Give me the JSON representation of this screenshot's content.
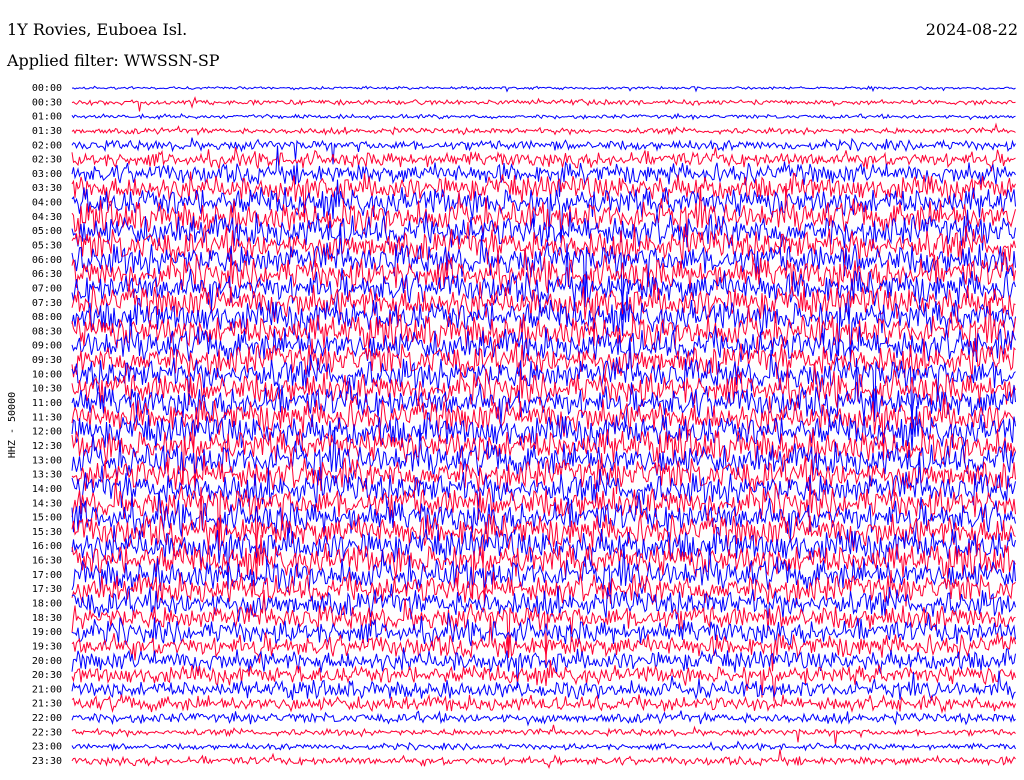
{
  "header": {
    "station": "1Y Rovies, Euboea Isl.",
    "filter": "Applied filter: WWSSN-SP",
    "date": "2024-08-22"
  },
  "chart_data": {
    "type": "line",
    "title": "1Y Rovies, Euboea Isl.",
    "subtitle": "Applied filter: WWSSN-SP",
    "ylabel": "HHZ - 50000",
    "date": "2024-08-22",
    "rows": [
      "00:00",
      "00:30",
      "01:00",
      "01:30",
      "02:00",
      "02:30",
      "03:00",
      "03:30",
      "04:00",
      "04:30",
      "05:00",
      "05:30",
      "06:00",
      "06:30",
      "07:00",
      "07:30",
      "08:00",
      "08:30",
      "09:00",
      "09:30",
      "10:00",
      "10:30",
      "11:00",
      "11:30",
      "12:00",
      "12:30",
      "13:00",
      "13:30",
      "14:00",
      "14:30",
      "15:00",
      "15:30",
      "16:00",
      "16:30",
      "17:00",
      "17:30",
      "18:00",
      "18:30",
      "19:00",
      "19:30",
      "20:00",
      "20:30",
      "21:00",
      "21:30",
      "22:00",
      "22:30",
      "23:00",
      "23:30"
    ],
    "series_colors": [
      "#0000ff",
      "#ff0033"
    ],
    "amplitude_profile": [
      0.08,
      0.15,
      0.12,
      0.18,
      0.3,
      0.45,
      0.6,
      0.75,
      0.85,
      0.9,
      0.95,
      0.95,
      0.95,
      0.95,
      0.95,
      0.95,
      0.95,
      0.95,
      0.95,
      0.95,
      0.95,
      0.95,
      0.95,
      0.95,
      0.95,
      0.95,
      0.95,
      0.95,
      0.95,
      0.95,
      0.95,
      0.95,
      0.95,
      0.95,
      0.9,
      0.85,
      0.8,
      0.75,
      0.7,
      0.65,
      0.6,
      0.55,
      0.5,
      0.45,
      0.3,
      0.2,
      0.18,
      0.25
    ],
    "grid": false
  }
}
